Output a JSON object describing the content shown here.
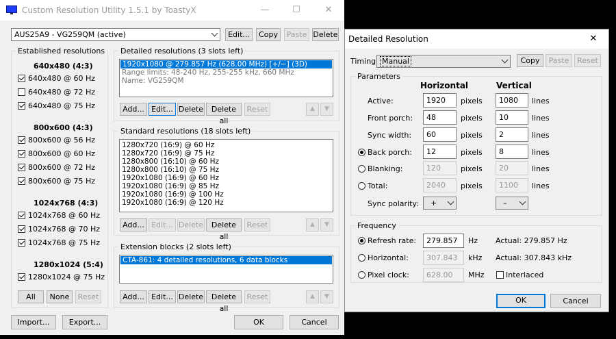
{
  "main": {
    "title": "Custom Resolution Utility 1.5.1 by ToastyX",
    "monitor": "AUS25A9 - VG259QM (active)",
    "top_buttons": {
      "edit": "Edit...",
      "copy": "Copy",
      "paste": "Paste",
      "delete": "Delete"
    },
    "established": {
      "label": "Established resolutions",
      "groups": [
        {
          "header": "640x480 (4:3)",
          "items": [
            {
              "label": "640x480 @ 60 Hz",
              "checked": true
            },
            {
              "label": "640x480 @ 72 Hz",
              "checked": false
            },
            {
              "label": "640x480 @ 75 Hz",
              "checked": true
            }
          ]
        },
        {
          "header": "800x600 (4:3)",
          "items": [
            {
              "label": "800x600 @ 56 Hz",
              "checked": true
            },
            {
              "label": "800x600 @ 60 Hz",
              "checked": true
            },
            {
              "label": "800x600 @ 72 Hz",
              "checked": true
            },
            {
              "label": "800x600 @ 75 Hz",
              "checked": true
            }
          ]
        },
        {
          "header": "1024x768 (4:3)",
          "items": [
            {
              "label": "1024x768 @ 60 Hz",
              "checked": true
            },
            {
              "label": "1024x768 @ 70 Hz",
              "checked": true
            },
            {
              "label": "1024x768 @ 75 Hz",
              "checked": true
            }
          ]
        },
        {
          "header": "1280x1024 (5:4)",
          "items": [
            {
              "label": "1280x1024 @ 75 Hz",
              "checked": true
            }
          ]
        }
      ],
      "buttons": {
        "all": "All",
        "none": "None",
        "reset": "Reset"
      }
    },
    "detailed": {
      "label": "Detailed resolutions (3 slots left)",
      "lines": [
        "1920x1080 @ 279.857 Hz (628.00 MHz) [+/−] (3D)",
        "Range limits: 48-240 Hz, 255-255 kHz, 660 MHz",
        "Name: VG259QM"
      ]
    },
    "standard": {
      "label": "Standard resolutions (18 slots left)",
      "lines": [
        "1280x720 (16:9) @ 60 Hz",
        "1280x720 (16:9) @ 75 Hz",
        "1280x800 (16:10) @ 60 Hz",
        "1280x800 (16:10) @ 75 Hz",
        "1920x1080 (16:9) @ 60 Hz",
        "1920x1080 (16:9) @ 85 Hz",
        "1920x1080 (16:9) @ 100 Hz",
        "1920x1080 (16:9) @ 120 Hz"
      ]
    },
    "extension": {
      "label": "Extension blocks (2 slots left)",
      "lines": [
        "CTA-861: 4 detailed resolutions, 6 data blocks"
      ]
    },
    "row_buttons": {
      "add": "Add...",
      "edit": "Edit...",
      "delete": "Delete",
      "delete_all": "Delete all",
      "reset": "Reset",
      "up": "▲",
      "down": "▼"
    },
    "bottom": {
      "import": "Import...",
      "export": "Export...",
      "ok": "OK",
      "cancel": "Cancel"
    }
  },
  "dialog": {
    "title": "Detailed Resolution",
    "timing_label": "Timing:",
    "timing_value": "Manual",
    "buttons": {
      "copy": "Copy",
      "paste": "Paste",
      "reset": "Reset"
    },
    "parameters": {
      "label": "Parameters",
      "h_header": "Horizontal",
      "v_header": "Vertical",
      "h_unit": "pixels",
      "v_unit": "lines",
      "rows": [
        {
          "label": "Active:",
          "h": "1920",
          "v": "1080",
          "radio": null
        },
        {
          "label": "Front porch:",
          "h": "48",
          "v": "10",
          "radio": null
        },
        {
          "label": "Sync width:",
          "h": "60",
          "v": "2",
          "radio": null
        },
        {
          "label": "Back porch:",
          "h": "12",
          "v": "8",
          "radio": "on"
        },
        {
          "label": "Blanking:",
          "h": "120",
          "v": "20",
          "radio": "off"
        },
        {
          "label": "Total:",
          "h": "2040",
          "v": "1100",
          "radio": "off"
        }
      ],
      "polarity_label": "Sync polarity:",
      "h_polarity": "+",
      "v_polarity": "–"
    },
    "frequency": {
      "label": "Frequency",
      "rows": [
        {
          "label": "Refresh rate:",
          "value": "279.857",
          "unit": "Hz",
          "actual": "Actual: 279.857 Hz",
          "selected": true
        },
        {
          "label": "Horizontal:",
          "value": "307.843",
          "unit": "kHz",
          "actual": "Actual: 307.843 kHz",
          "selected": false
        },
        {
          "label": "Pixel clock:",
          "value": "628.00",
          "unit": "MHz",
          "actual": "",
          "selected": false
        }
      ],
      "interlaced": "Interlaced"
    },
    "ok": "OK",
    "cancel": "Cancel"
  }
}
